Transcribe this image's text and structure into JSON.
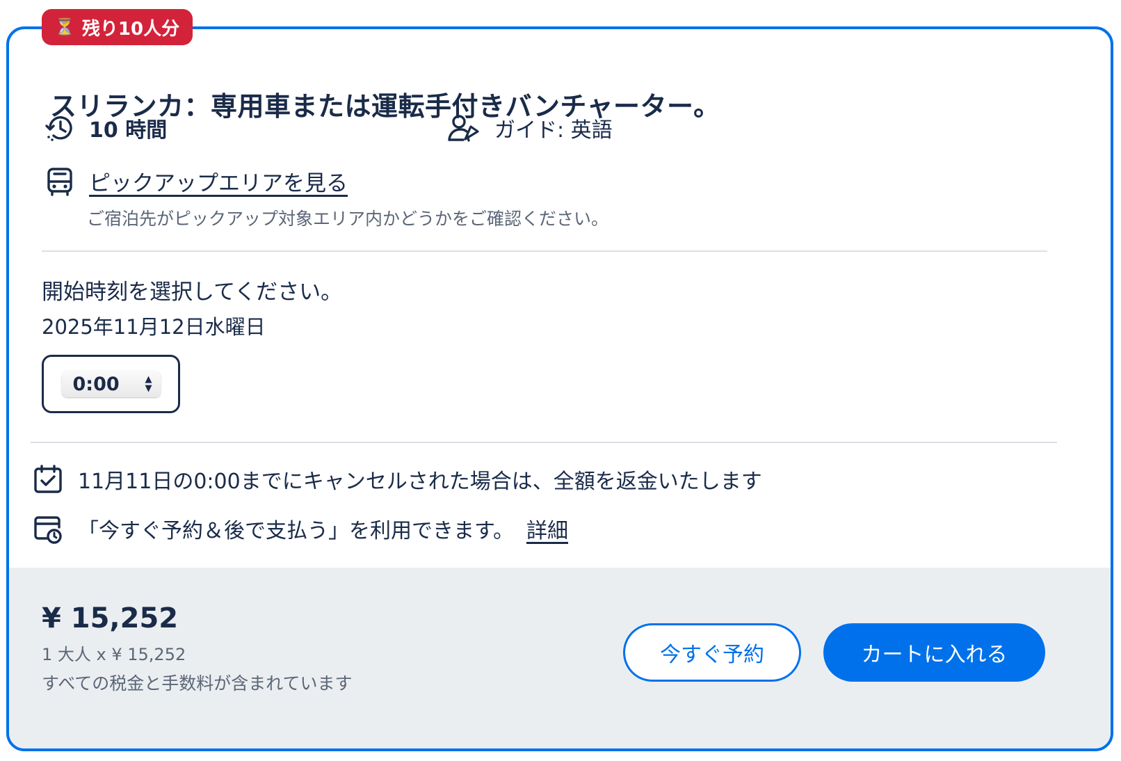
{
  "badge": {
    "icon": "hourglass-icon",
    "text": "残り10人分"
  },
  "title": "スリランカ：専用車または運転手付きバンチャーター。",
  "features": {
    "duration": {
      "icon": "clock-history-icon",
      "text": "10 時間"
    },
    "guide": {
      "icon": "guide-icon",
      "text": "ガイド: 英語"
    },
    "pickup": {
      "icon": "bus-icon",
      "link": "ピックアップエリアを見る",
      "sub": "ご宿泊先がピックアップ対象エリア内かどうかをご確認ください。"
    }
  },
  "schedule": {
    "prompt": "開始時刻を選択してください。",
    "date": "2025年11月12日水曜日",
    "time_value": "0:00"
  },
  "policies": {
    "cancel": {
      "icon": "calendar-check-icon",
      "text": "11月11日の0:00までにキャンセルされた場合は、全額を返金いたします"
    },
    "reserve": {
      "icon": "calendar-clock-icon",
      "text": "「今すぐ予約＆後で支払う」を利用できます。",
      "link": "詳細"
    }
  },
  "footer": {
    "price": "¥ 15,252",
    "unit": "1 大人 x ¥ 15,252",
    "tax": "すべての税金と手数料が含まれています",
    "book_now": "今すぐ予約",
    "add_to_cart": "カートに入れる"
  },
  "colors": {
    "accent": "#0071eb",
    "badge": "#d3233a",
    "text": "#1a2b49",
    "footer_bg": "#ebeef1"
  }
}
